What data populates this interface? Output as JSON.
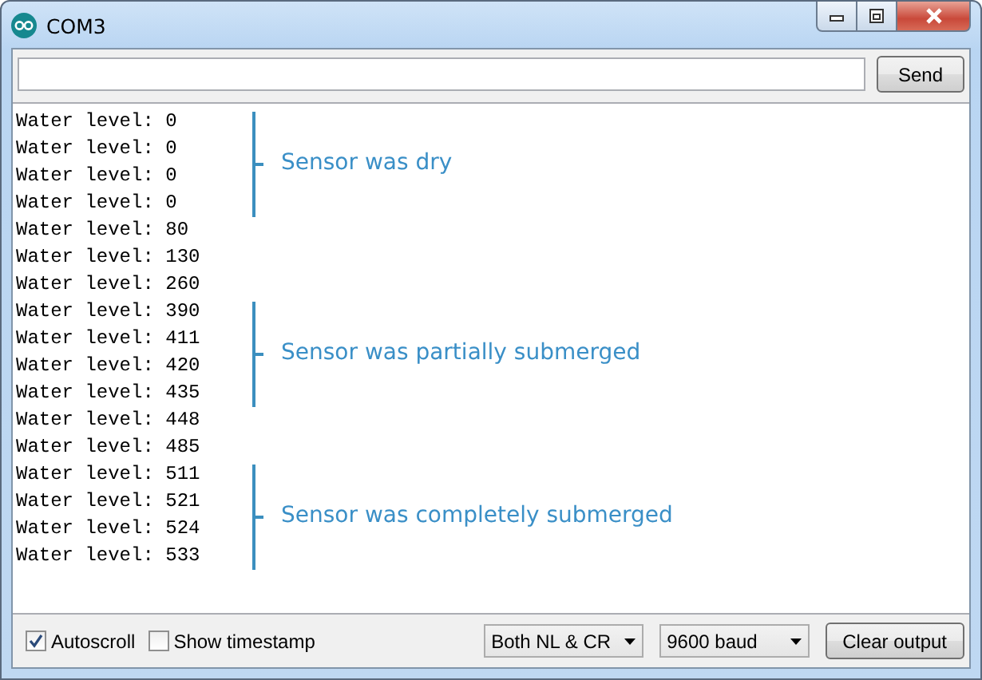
{
  "window": {
    "title": "COM3"
  },
  "send_button": "Send",
  "output": [
    {
      "lines": [
        "Water level: 0",
        "Water level: 0",
        "Water level: 0",
        "Water level: 0"
      ],
      "note": "Sensor was dry"
    },
    {
      "lines": [
        "Water level: 80",
        "Water level: 130",
        "Water level: 260"
      ]
    },
    {
      "lines": [
        "Water level: 390",
        "Water level: 411",
        "Water level: 420",
        "Water level: 435"
      ],
      "note": "Sensor was partially submerged"
    },
    {
      "lines": [
        "Water level: 448",
        "Water level: 485"
      ]
    },
    {
      "lines": [
        "Water level: 511",
        "Water level: 521",
        "Water level: 524",
        "Water level: 533"
      ],
      "note": "Sensor was completely submerged"
    }
  ],
  "options": [
    {
      "kind": "checkbox",
      "label": "Autoscroll",
      "checked": true
    },
    {
      "kind": "checkbox",
      "label": "Show timestamp",
      "checked": false
    }
  ],
  "dropdowns": [
    {
      "value": "Both NL & CR"
    },
    {
      "value": "9600 baud"
    }
  ],
  "clear_button": "Clear output"
}
